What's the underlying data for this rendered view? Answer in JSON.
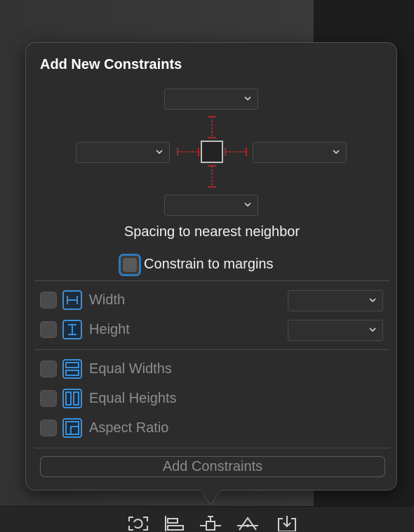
{
  "popover": {
    "title": "Add New Constraints",
    "spacing_label": "Spacing to nearest neighbor",
    "margins_label": "Constrain to margins",
    "top_value": "",
    "left_value": "",
    "right_value": "",
    "bottom_value": "",
    "rows": [
      {
        "label": "Width",
        "icon": "width-icon",
        "value": ""
      },
      {
        "label": "Height",
        "icon": "height-icon",
        "value": ""
      },
      {
        "label": "Equal Widths",
        "icon": "equal-widths-icon"
      },
      {
        "label": "Equal Heights",
        "icon": "equal-heights-icon"
      },
      {
        "label": "Aspect Ratio",
        "icon": "aspect-ratio-icon"
      }
    ],
    "add_button": "Add Constraints"
  },
  "colors": {
    "accent": "#2f79b9",
    "constraint_line": "#a3272b",
    "icon_blue": "#3d8fd6"
  },
  "toolbar_icons": [
    "update-frames-icon",
    "align-icon",
    "add-constraints-icon",
    "resolve-issues-icon",
    "embed-icon"
  ]
}
